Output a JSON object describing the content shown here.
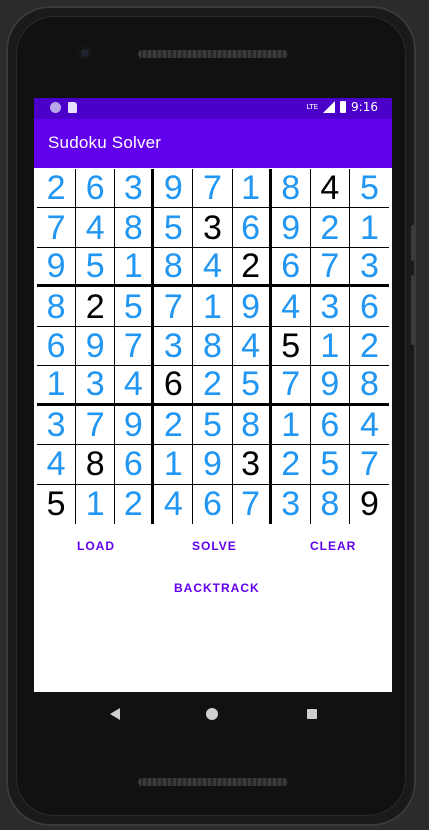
{
  "status_bar": {
    "time": "9:16",
    "network": "LTE"
  },
  "app": {
    "title": "Sudoku Solver",
    "primary_color": "#6200ee",
    "status_color": "#4a00c8",
    "solved_color": "#2196f3",
    "given_color": "#000000"
  },
  "board": {
    "rows": [
      [
        "2",
        "6",
        "3",
        "9",
        "7",
        "1",
        "8",
        "4",
        "5"
      ],
      [
        "7",
        "4",
        "8",
        "5",
        "3",
        "6",
        "9",
        "2",
        "1"
      ],
      [
        "9",
        "5",
        "1",
        "8",
        "4",
        "2",
        "6",
        "7",
        "3"
      ],
      [
        "8",
        "2",
        "5",
        "7",
        "1",
        "9",
        "4",
        "3",
        "6"
      ],
      [
        "6",
        "9",
        "7",
        "3",
        "8",
        "4",
        "5",
        "1",
        "2"
      ],
      [
        "1",
        "3",
        "4",
        "6",
        "2",
        "5",
        "7",
        "9",
        "8"
      ],
      [
        "3",
        "7",
        "9",
        "2",
        "5",
        "8",
        "1",
        "6",
        "4"
      ],
      [
        "4",
        "8",
        "6",
        "1",
        "9",
        "3",
        "2",
        "5",
        "7"
      ],
      [
        "5",
        "1",
        "2",
        "4",
        "6",
        "7",
        "3",
        "8",
        "9"
      ]
    ],
    "given": [
      [
        0,
        0,
        0,
        0,
        0,
        0,
        0,
        1,
        0
      ],
      [
        0,
        0,
        0,
        0,
        1,
        0,
        0,
        0,
        0
      ],
      [
        0,
        0,
        0,
        0,
        0,
        1,
        0,
        0,
        0
      ],
      [
        0,
        1,
        0,
        0,
        0,
        0,
        0,
        0,
        0
      ],
      [
        0,
        0,
        0,
        0,
        0,
        0,
        1,
        0,
        0
      ],
      [
        0,
        0,
        0,
        1,
        0,
        0,
        0,
        0,
        0
      ],
      [
        0,
        0,
        0,
        0,
        0,
        0,
        0,
        0,
        0
      ],
      [
        0,
        1,
        0,
        0,
        0,
        1,
        0,
        0,
        0
      ],
      [
        1,
        0,
        0,
        0,
        0,
        0,
        0,
        0,
        1
      ]
    ]
  },
  "buttons": {
    "load": "LOAD",
    "solve": "SOLVE",
    "clear": "CLEAR",
    "backtrack": "BACKTRACK"
  },
  "nav": {
    "back_icon": "back-triangle",
    "home_icon": "home-circle",
    "recents_icon": "recents-square"
  }
}
